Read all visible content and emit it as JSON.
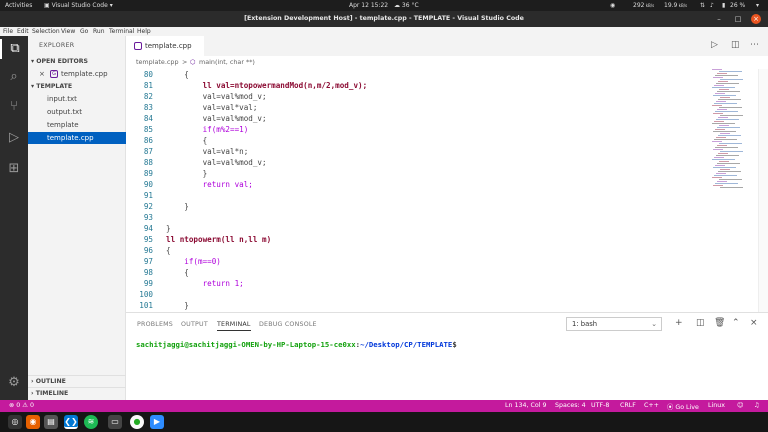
{
  "system": {
    "activities": "Activities",
    "app_menu": "Visual Studio Code",
    "datetime": "Apr 12  15:22",
    "weather": "36 °C",
    "net_down": "292",
    "net_up": "19.9",
    "battery": "26 %"
  },
  "window": {
    "title": "[Extension Development Host] - template.cpp - TEMPLATE - Visual Studio Code"
  },
  "menu": [
    "File",
    "Edit",
    "Selection",
    "View",
    "Go",
    "Run",
    "Terminal",
    "Help"
  ],
  "sidebar": {
    "header": "EXPLORER",
    "open_editors_label": "OPEN EDITORS",
    "open_file": "template.cpp",
    "open_file_icon": "G",
    "folder_label": "TEMPLATE",
    "files": [
      "input.txt",
      "output.txt",
      "template",
      "template.cpp"
    ],
    "outline_label": "OUTLINE",
    "timeline_label": "TIMELINE"
  },
  "editor": {
    "tab_label": "template.cpp",
    "breadcrumb_file": "template.cpp",
    "breadcrumb_sep": ">",
    "breadcrumb_symbol": "main(int, char **)",
    "lines": [
      {
        "n": "80",
        "t": "    {"
      },
      {
        "n": "81",
        "t": "        ll val=ntopowermandMod(n,m/2,mod_v);"
      },
      {
        "n": "82",
        "t": "        val=val%mod_v;"
      },
      {
        "n": "83",
        "t": "        val=val*val;"
      },
      {
        "n": "84",
        "t": "        val=val%mod_v;"
      },
      {
        "n": "85",
        "t": "        if(m%2==1)"
      },
      {
        "n": "86",
        "t": "        {"
      },
      {
        "n": "87",
        "t": "        val=val*n;"
      },
      {
        "n": "88",
        "t": "        val=val%mod_v;"
      },
      {
        "n": "89",
        "t": "        }"
      },
      {
        "n": "90",
        "t": "        return val;"
      },
      {
        "n": "91",
        "t": ""
      },
      {
        "n": "92",
        "t": "    }"
      },
      {
        "n": "93",
        "t": ""
      },
      {
        "n": "94",
        "t": "}"
      },
      {
        "n": "95",
        "t": "ll ntopowerm(ll n,ll m)"
      },
      {
        "n": "96",
        "t": "{"
      },
      {
        "n": "97",
        "t": "    if(m==0)"
      },
      {
        "n": "98",
        "t": "    {"
      },
      {
        "n": "99",
        "t": "        return 1;"
      },
      {
        "n": "100",
        "t": ""
      },
      {
        "n": "101",
        "t": "    }"
      }
    ]
  },
  "panel": {
    "tabs": [
      "PROBLEMS",
      "OUTPUT",
      "TERMINAL",
      "DEBUG CONSOLE"
    ],
    "active_tab": "TERMINAL",
    "terminal_select": "1: bash",
    "prompt_user": "sachitjaggi@sachitjaggi-OMEN-by-HP-Laptop-15-ce0xx",
    "prompt_sep": ":",
    "prompt_path": "~/Desktop/CP/TEMPLATE",
    "prompt_end": "$"
  },
  "status": {
    "errors": "0",
    "warnings": "0",
    "position": "Ln 134, Col 9",
    "spaces": "Spaces: 4",
    "encoding": "UTF-8",
    "eol": "CRLF",
    "language": "C++",
    "golive": "Go Live",
    "os": "Linux"
  },
  "colors": {
    "status_bar": "#c41a9d",
    "selection": "#0060c0",
    "keyword": "#af00db",
    "function": "#8b0a32",
    "terminal_user": "#13a10e",
    "terminal_path": "#0037da"
  }
}
